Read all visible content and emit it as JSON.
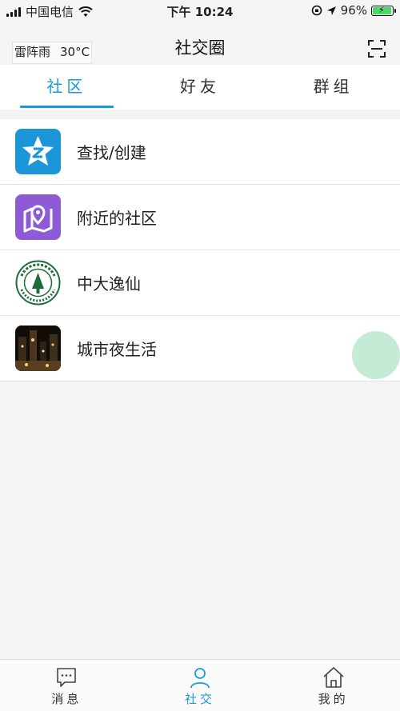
{
  "status_bar": {
    "carrier": "中国电信",
    "time": "下午 10:24",
    "battery": "96%",
    "battery_level": 0.96
  },
  "header": {
    "weather_condition": "雷阵雨",
    "weather_temp": "30°C",
    "title": "社交圈",
    "scan_icon": "scan-icon"
  },
  "tabs": [
    {
      "label": "社区",
      "active": true
    },
    {
      "label": "好友",
      "active": false
    },
    {
      "label": "群组",
      "active": false
    }
  ],
  "list": [
    {
      "label": "查找/创建",
      "icon": "find-create-icon"
    },
    {
      "label": "附近的社区",
      "icon": "nearby-map-icon"
    },
    {
      "label": "中大逸仙",
      "icon": "sysu-logo"
    },
    {
      "label": "城市夜生活",
      "icon": "city-night-photo"
    }
  ],
  "bottom_nav": [
    {
      "label": "消息",
      "icon": "message-icon",
      "active": false
    },
    {
      "label": "社交",
      "icon": "person-icon",
      "active": true
    },
    {
      "label": "我的",
      "icon": "home-icon",
      "active": false
    }
  ],
  "colors": {
    "accent": "#1a9ad7",
    "find_icon_bg": "#1b96d8",
    "nearby_icon_bg": "#8e5bd6",
    "float_button": "#bfe9d2"
  }
}
